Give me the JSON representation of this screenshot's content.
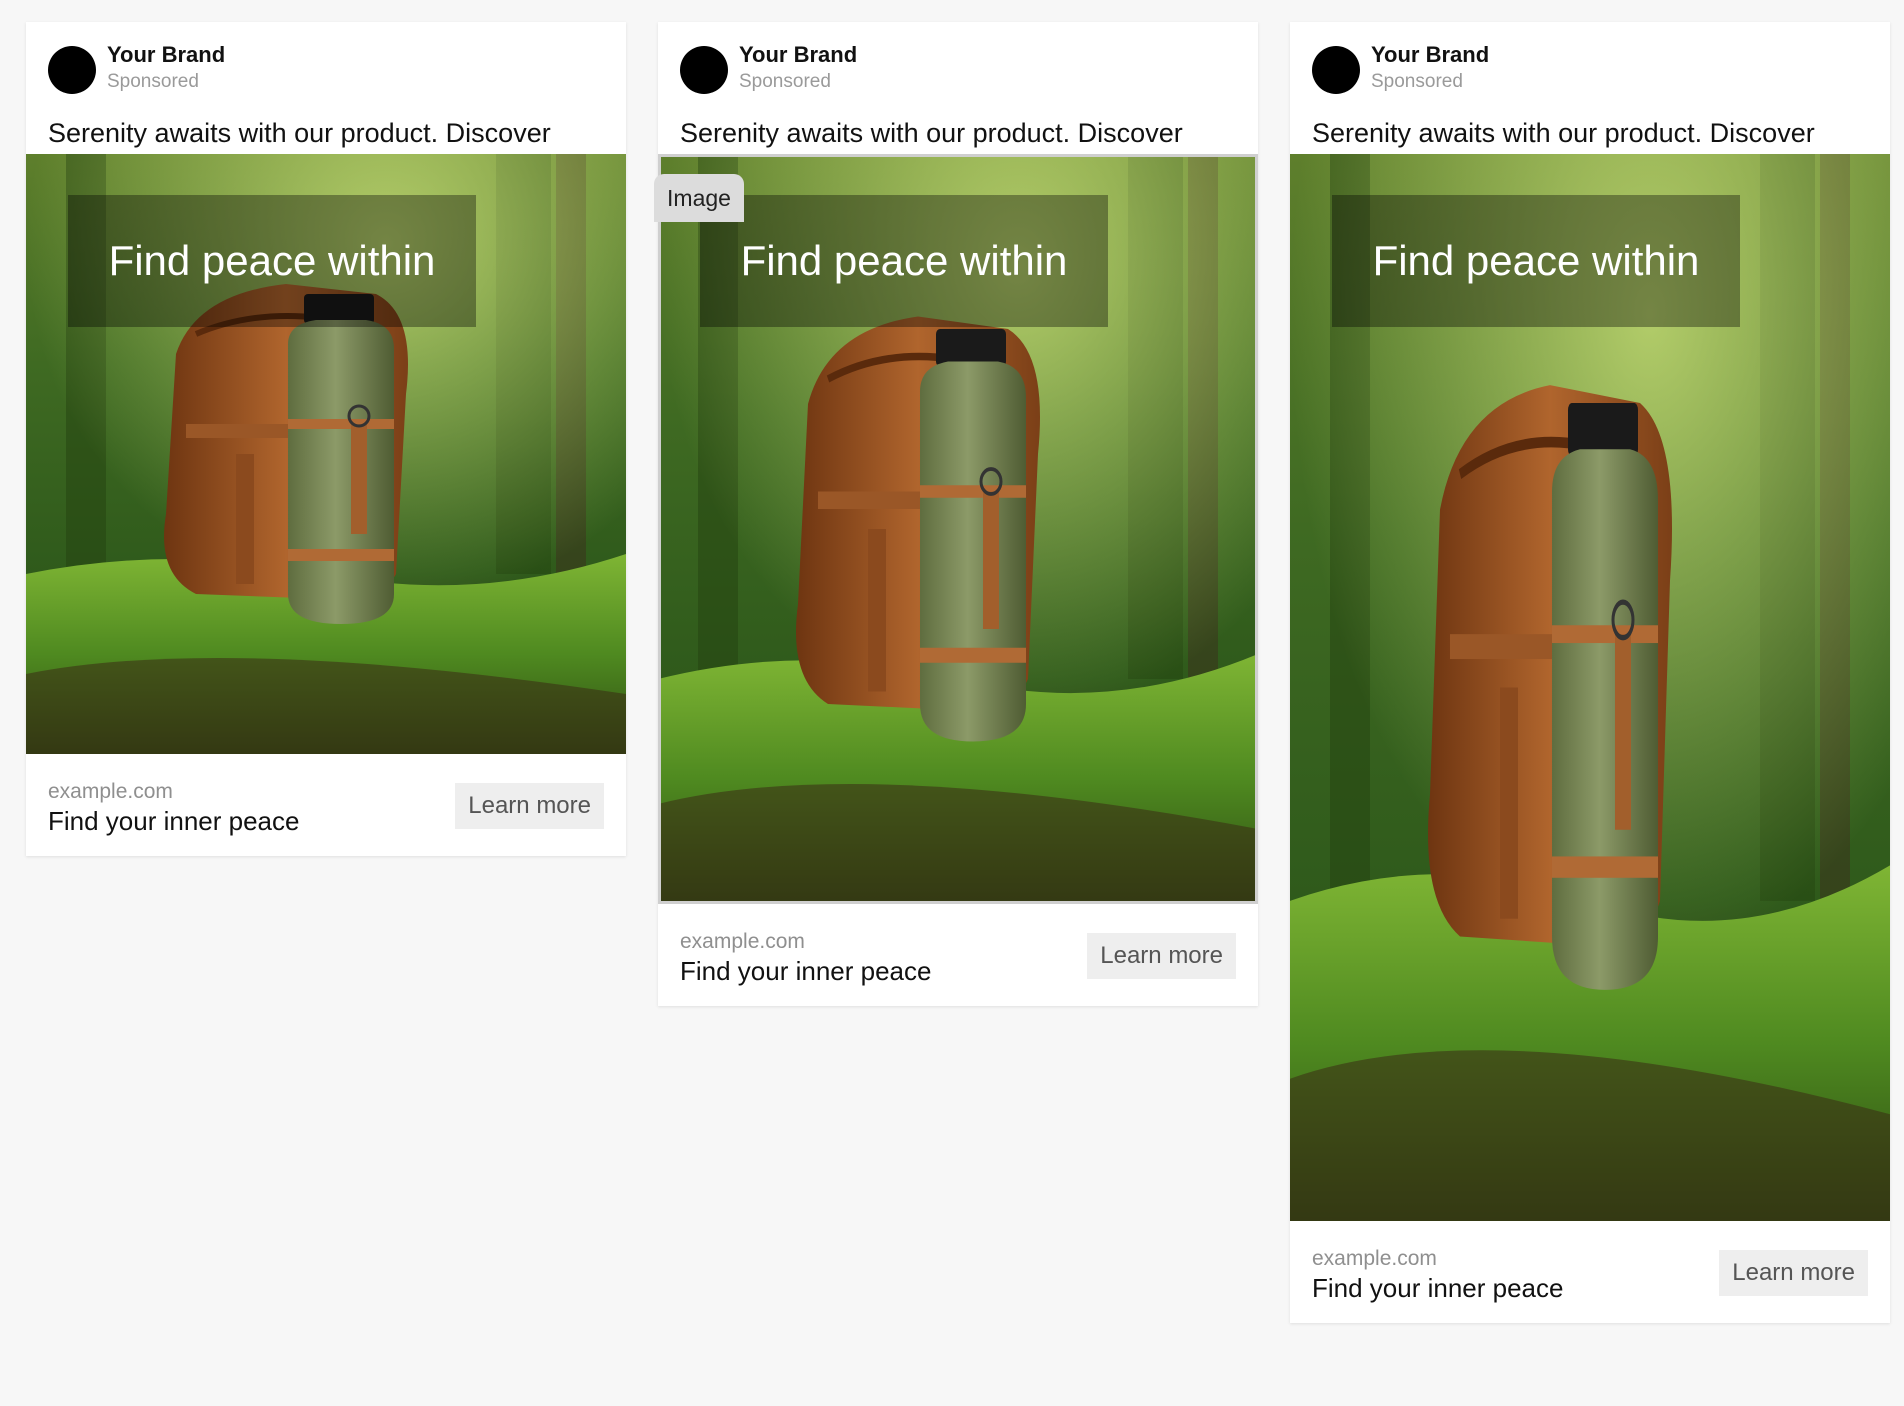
{
  "ads": [
    {
      "brand": "Your Brand",
      "sponsored": "Sponsored",
      "primary_text": "Serenity awaits with our product. Discover peace like never before. Dive into tranquility today!",
      "headline_overlay": "Find peace within",
      "domain": "example.com",
      "title": "Find your inner peace",
      "cta": "Learn more"
    },
    {
      "brand": "Your Brand",
      "sponsored": "Sponsored",
      "primary_text": "Serenity awaits with our product. Discover peace like never before. Dive into tranquility today!",
      "headline_overlay": "Find peace within",
      "image_tag": "Image",
      "domain": "example.com",
      "title": "Find your inner peace",
      "cta": "Learn more"
    },
    {
      "brand": "Your Brand",
      "sponsored": "Sponsored",
      "primary_text": "Serenity awaits with our product. Discover peace like never before. Dive into tranquility today!",
      "headline_overlay": "Find peace within",
      "domain": "example.com",
      "title": "Find your inner peace",
      "cta": "Learn more"
    }
  ]
}
